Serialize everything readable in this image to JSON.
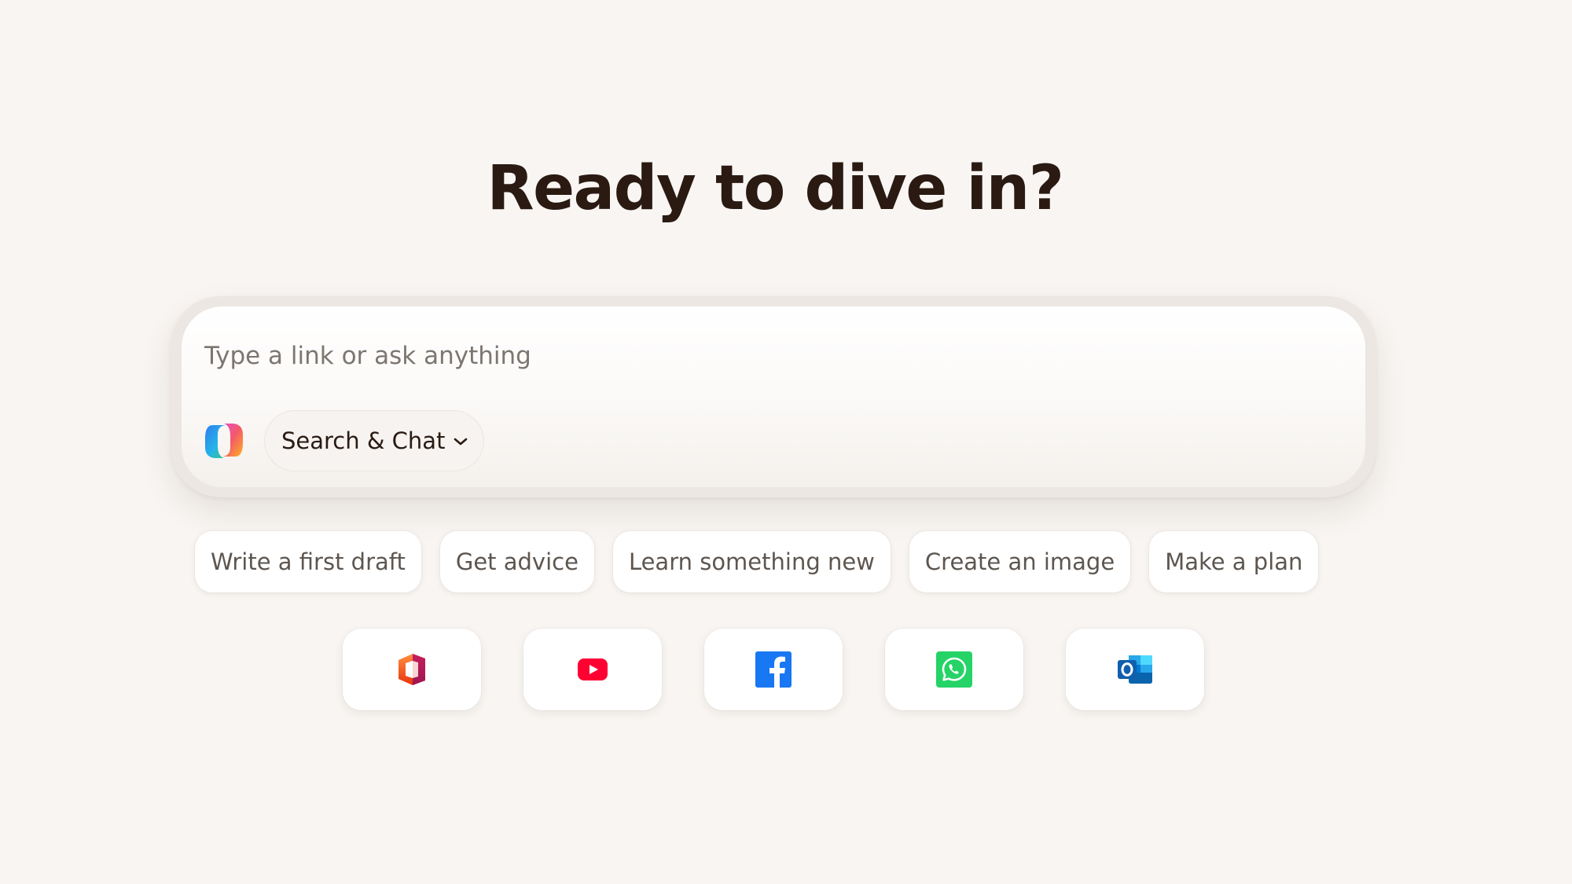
{
  "headline": "Ready to dive in?",
  "composer": {
    "placeholder": "Type a link or ask anything",
    "value": "",
    "logo_icon": "copilot-logo-icon",
    "mode": {
      "label": "Search & Chat",
      "icon": "chevron-down-icon"
    }
  },
  "suggestions": [
    {
      "label": "Write a first draft"
    },
    {
      "label": "Get advice"
    },
    {
      "label": "Learn something new"
    },
    {
      "label": "Create an image"
    },
    {
      "label": "Make a plan"
    }
  ],
  "shortcuts": [
    {
      "icon": "office-icon",
      "color": "#eb3c00"
    },
    {
      "icon": "youtube-icon",
      "color": "#ff0033"
    },
    {
      "icon": "facebook-icon",
      "color": "#1877f2"
    },
    {
      "icon": "whatsapp-icon",
      "color": "#25d366"
    },
    {
      "icon": "outlook-icon",
      "color": "#0078d4"
    }
  ],
  "colors": {
    "background": "#f8f5f2",
    "headline": "#2a1a12",
    "placeholder": "#7d7670",
    "chip_text": "#5d5650"
  }
}
